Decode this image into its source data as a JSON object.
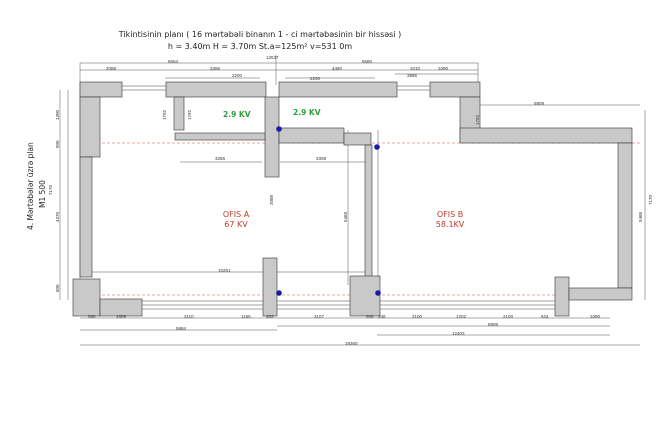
{
  "header": {
    "title_line1": "Tikintisinin planı ( 16 mərtəbəli binanın 1 - ci mərtəbəsinin bir hissəsi )",
    "title_line2": "h = 3.40m  H = 3.70m  St.a=125m²   v=531 0m"
  },
  "side_label": {
    "line1": "4. Mərtəbələr üzrə plan",
    "line2": "M1 500"
  },
  "rooms": {
    "a_name": "OFIS A",
    "a_power": "67 KV",
    "b_name": "OFIS B",
    "b_power": "58.1KV",
    "kv_left": "2.9 KV",
    "kv_right": "2.9 KV"
  },
  "dims_top": {
    "d12537": "12537",
    "d6554": "6554",
    "d6580": "6580",
    "d2088": "2088",
    "d3456": "3456",
    "d4480": "4480",
    "d1010": "1010",
    "d1090": "1090",
    "d2200a": "2200",
    "d2200b": "2200",
    "d3886": "3886",
    "d5809": "5809"
  },
  "dims_mid": {
    "d3256": "3256",
    "d3308": "3308",
    "d10251": "10251",
    "d1792a": "1792",
    "d1792b": "1792",
    "d1792c": "1792"
  },
  "dims_bottom": {
    "b590": "590",
    "b1609": "1609",
    "b3110": "3110",
    "b1165": "1165",
    "b483": "483",
    "b3107": "3107",
    "b508": "508",
    "b248": "248",
    "b2100a": "2100",
    "b1202": "1202",
    "b2100b": "2100",
    "b624": "624",
    "b1090": "1090",
    "b5884": "5884",
    "b8909": "8909",
    "b12403": "12403",
    "b19360": "19360"
  },
  "dims_left": {
    "l1300": "1300",
    "l900": "900",
    "l7170": "7170",
    "l4370": "4370",
    "l600": "600"
  },
  "dims_inner": {
    "i5468a": "5468",
    "i5468b": "5468",
    "i2088": "2088"
  },
  "dims_right": {
    "r7170": "7170"
  },
  "colors": {
    "wall": "#c9c9c9",
    "wall_stroke": "#333333",
    "dim_line": "#555555",
    "dashed": "#d9534f",
    "room_text": "#c0392b",
    "kv_text": "#2e9e3a",
    "pin": "#1a1aa8"
  }
}
